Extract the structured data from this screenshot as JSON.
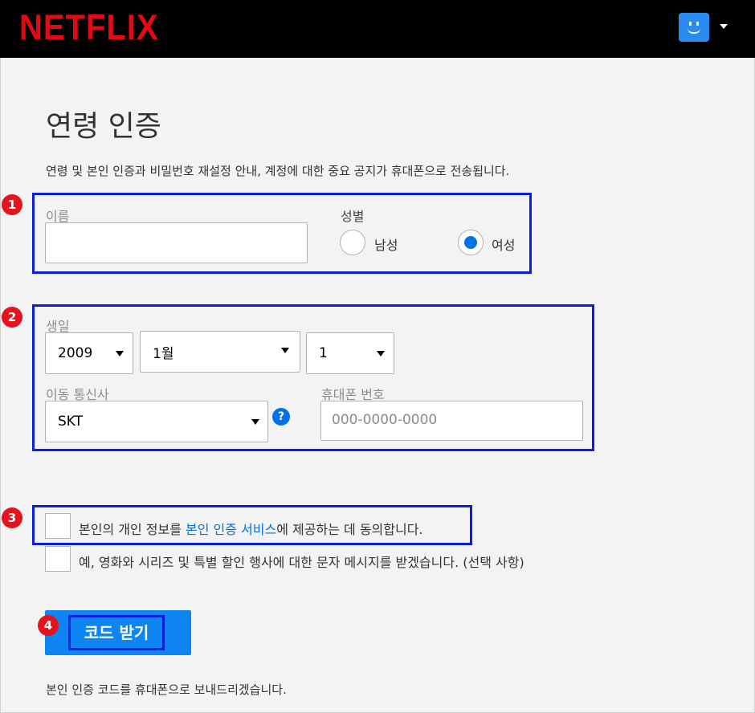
{
  "header": {
    "logo": "NETFLIX"
  },
  "page": {
    "title": "연령 인증",
    "description": "연령 및 본인 인증과 비밀번호 재설정 안내, 계정에 대한 중요 공지가 휴대폰으로 전송됩니다."
  },
  "badges": [
    "1",
    "2",
    "3",
    "4"
  ],
  "name_section": {
    "name_label": "이름",
    "name_value": "",
    "gender_label": "성별",
    "male_label": "남성",
    "female_label": "여성",
    "selected": "여성"
  },
  "birth_section": {
    "birthday_label": "생일",
    "year": "2009",
    "month": "1월",
    "day": "1",
    "carrier_label": "이동 통신사",
    "carrier": "SKT",
    "help_glyph": "?",
    "phone_label": "휴대폰 번호",
    "phone_placeholder": "000-0000-0000"
  },
  "consent": {
    "consent_pre": "본인의 개인 정보를 ",
    "consent_link": "본인 인증 서비스",
    "consent_post": "에 제공하는 데 동의합니다.",
    "marketing": "예, 영화와 시리즈 및 특별 할인 행사에 대한 문자 메시지를 받겠습니다. (선택 사항)"
  },
  "actions": {
    "get_code": "코드 받기",
    "note": "본인 인증 코드를 휴대폰으로 보내드리겠습니다."
  },
  "colors": {
    "brand": "#e50914",
    "accent": "#0071eb",
    "button": "#0f84f3",
    "highlight_box": "#0a1ee0",
    "badge": "#e5131e"
  }
}
